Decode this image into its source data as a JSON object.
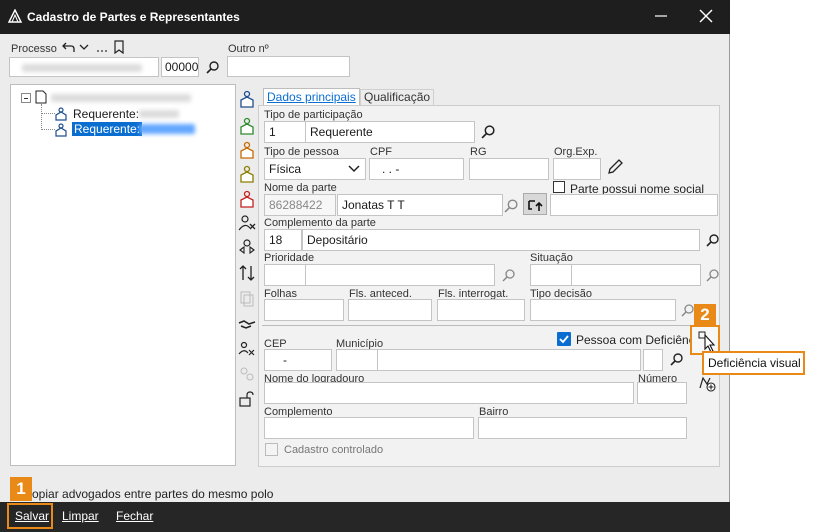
{
  "window": {
    "title": "Cadastro de Partes e Representantes"
  },
  "processo": {
    "label": "Processo",
    "suffix": "00000",
    "outro_label": "Outro nº",
    "outro_value": ""
  },
  "tree": {
    "item1": "Requerente:",
    "item2": "Requerente:"
  },
  "tabs": {
    "dados": "Dados principais",
    "qualificacao": "Qualificação"
  },
  "form": {
    "tipo_participacao_label": "Tipo de participação",
    "tipo_participacao_code": "1",
    "tipo_participacao_value": "Requerente",
    "tipo_pessoa_label": "Tipo de pessoa",
    "tipo_pessoa_value": "Física",
    "cpf_label": "CPF",
    "cpf_value": ". . -",
    "rg_label": "RG",
    "org_label": "Org.Exp.",
    "nome_label": "Nome da parte",
    "nome_code": "86288422",
    "nome_value": "Jonatas T T",
    "nome_social_label": "Parte possui nome social",
    "complemento_parte_label": "Complemento da parte",
    "complemento_parte_code": "18",
    "complemento_parte_value": "Depositário",
    "prioridade_label": "Prioridade",
    "situacao_label": "Situação",
    "folhas_label": "Folhas",
    "fls_anteced_label": "Fls. anteced.",
    "fls_interrog_label": "Fls. interrogat.",
    "tipo_decisao_label": "Tipo decisão",
    "pessoa_deficiencia_label": "Pessoa com Deficiência",
    "cep_label": "CEP",
    "cep_value": "-",
    "municipio_label": "Município",
    "logradouro_label": "Nome do logradouro",
    "numero_label": "Número",
    "complemento_label": "Complemento",
    "bairro_label": "Bairro",
    "cadastro_controlado_label": "Cadastro controlado"
  },
  "tooltip": {
    "text": "Deficiência visual"
  },
  "copiar_label": "opiar advogados entre partes do mesmo polo",
  "bottom": {
    "salvar": "Salvar",
    "limpar": "Limpar",
    "fechar": "Fechar"
  },
  "callouts": {
    "one": "1",
    "two": "2"
  },
  "colors": {
    "accent": "#0a6ed1",
    "callout": "#e98918",
    "titlebar": "#1e1e1e"
  }
}
